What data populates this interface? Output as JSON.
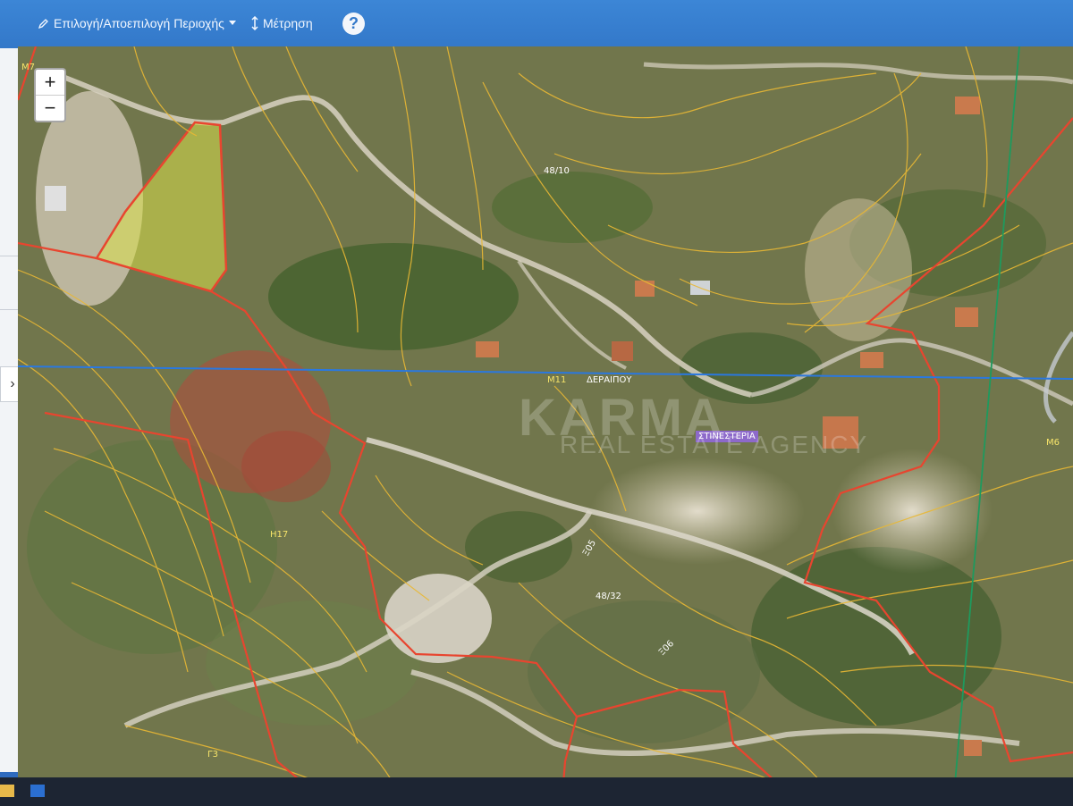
{
  "toolbar": {
    "select_area_label": "Επιλογή/Αποεπιλογή Περιοχής",
    "measure_label": "Μέτρηση",
    "help_label": "?",
    "icons": [
      "pencil-icon",
      "caret-down-icon",
      "measure-arrows-icon",
      "help-icon"
    ]
  },
  "left_panel": {
    "toggle_label": "›"
  },
  "map": {
    "zoom_in_label": "+",
    "zoom_out_label": "−",
    "labels": {
      "m7": "M7",
      "m6": "M6",
      "m11": "M11",
      "n17": "Η17",
      "r13": "Γ3",
      "parcel_4810": "48/10",
      "parcel_4832": "48/32",
      "village": "ΔΕΡΑΙΠΟΥ",
      "locality": "ΣΤΙΝΕΣΤΕΡΙΑ",
      "road_1": "Ξ05",
      "road_2": "Ξ06"
    },
    "watermark": {
      "main": "KARMA",
      "sub": "REAL ESTATE AGENCY"
    },
    "colors": {
      "parcel_boundary": "#e8452f",
      "contour": "#e9b834",
      "selected_parcel": "#d8e04a",
      "grid_blue": "#2a78e0",
      "grid_green": "#1e9a5e"
    }
  }
}
